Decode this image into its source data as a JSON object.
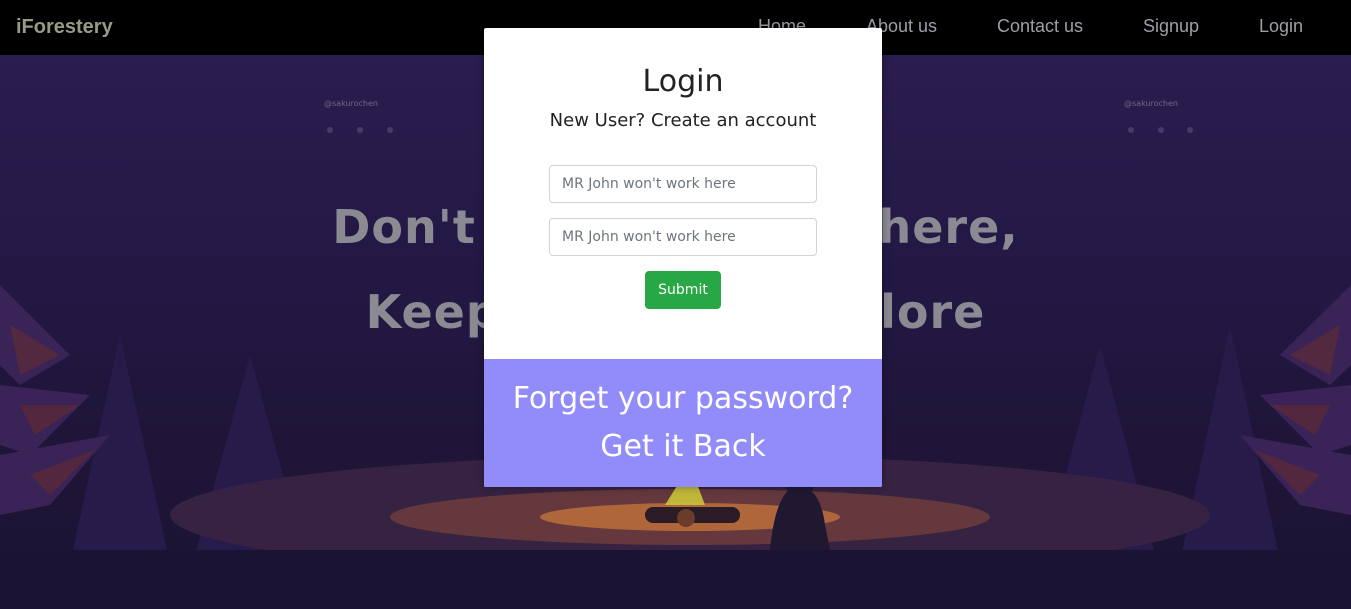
{
  "nav": {
    "brand": "iForestery",
    "links": [
      "Home",
      "About us",
      "Contact us",
      "Signup",
      "Login"
    ]
  },
  "hero": {
    "line1": "Don't be a Stranger here,",
    "line2": "Keep Calm and Explore",
    "watermark": "@sakurochen"
  },
  "modal": {
    "title": "Login",
    "subtitle": "New User? Create an account",
    "field1_placeholder": "MR John won't work here",
    "field2_placeholder": "MR John won't work here",
    "submit_label": "Submit",
    "footer_line1": "Forget your password?",
    "footer_line2": "Get it Back"
  },
  "colors": {
    "nav_bg": "#000000",
    "submit_green": "#28a745",
    "footer_purple": "#928bfa",
    "hero_bg": "#231844"
  }
}
